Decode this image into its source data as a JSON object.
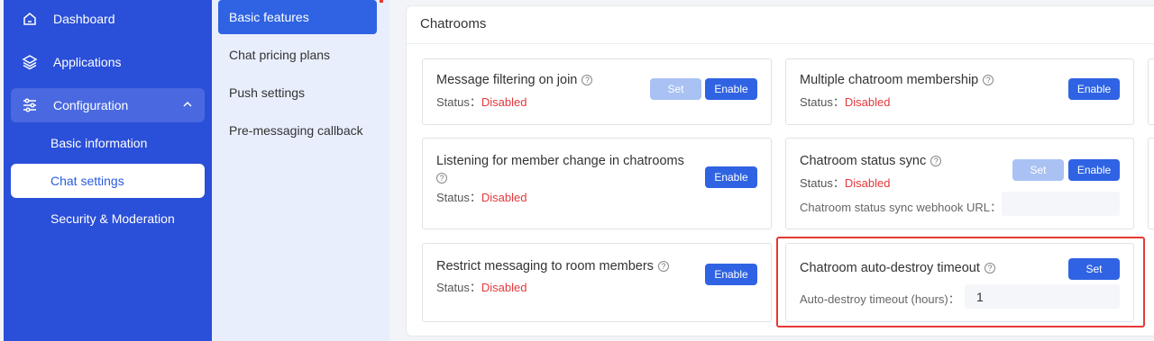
{
  "sidebar": {
    "items": [
      {
        "label": "Dashboard",
        "icon": "home-icon"
      },
      {
        "label": "Applications",
        "icon": "layers-icon"
      },
      {
        "label": "Configuration",
        "icon": "sliders-icon",
        "expanded": true
      }
    ],
    "sub_items": [
      {
        "label": "Basic information"
      },
      {
        "label": "Chat settings",
        "selected": true
      },
      {
        "label": "Security & Moderation"
      }
    ]
  },
  "secondary_nav": {
    "items": [
      {
        "label": "Basic features",
        "selected": true
      },
      {
        "label": "Chat pricing plans"
      },
      {
        "label": "Push settings"
      },
      {
        "label": "Pre-messaging callback"
      }
    ]
  },
  "panel": {
    "title": "Chatrooms",
    "status_prefix": "Status：",
    "cards": {
      "message_filtering": {
        "title": "Message filtering on join",
        "status": "Disabled",
        "set_label": "Set",
        "enable_label": "Enable"
      },
      "multiple_membership": {
        "title": "Multiple chatroom membership",
        "status": "Disabled",
        "enable_label": "Enable"
      },
      "listening_member_change": {
        "title": "Listening for member change in chatrooms",
        "status": "Disabled",
        "enable_label": "Enable"
      },
      "status_sync": {
        "title": "Chatroom status sync",
        "status": "Disabled",
        "set_label": "Set",
        "enable_label": "Enable",
        "webhook_label": "Chatroom status sync webhook URL：",
        "webhook_value": ""
      },
      "restrict_messaging": {
        "title": "Restrict messaging to room members",
        "status": "Disabled",
        "enable_label": "Enable"
      },
      "auto_destroy": {
        "title": "Chatroom auto-destroy timeout",
        "set_label": "Set",
        "timeout_label": "Auto-destroy timeout (hours)：",
        "timeout_value": "1"
      }
    }
  },
  "colors": {
    "sidebar_bg": "#2a4fd8",
    "accent": "#2f63e3",
    "disabled_status": "#e4393c",
    "highlight": "#e53935"
  }
}
